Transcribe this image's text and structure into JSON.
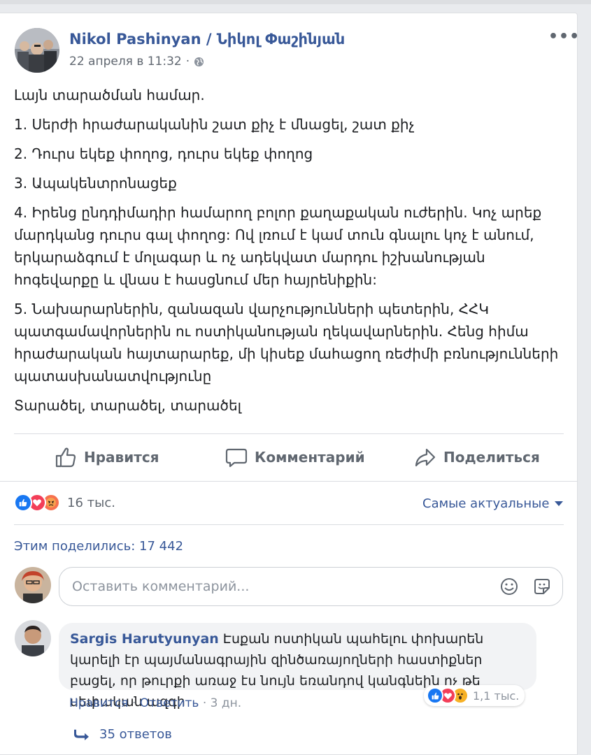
{
  "post": {
    "author": "Nikol Pashinyan / Նիկոլ Փաշինյան",
    "timestamp": "22 апреля в 11:32",
    "timestamp_sep": "·",
    "more": "•••",
    "paragraphs": [
      "Լայն տարածման համար.",
      "1. Սերժի հրաժարականին շատ քիչ է մնացել, շատ քիչ",
      "2. Դուրս եկեք փողոց, դուրս եկեք փողոց",
      "3. Ապակենտրոնացեք",
      "4. Իրենց ընդդիմադիր համարող բոլոր քաղաքական ուժերին. Կոչ արեք մարդկանց դուրս գալ փողոց: Ով լռում է կամ տուն գնալու կոչ է անում, երկարաձգում է մոլագար և ոչ ադեկվատ մարդու իշխանության հոգեվարքը և վնաս է հասցնում մեր հայրենիքին:",
      "5. Նախարարներին, զանազան վարչությունների պետերին, ՀՀԿ պատգամավորներին ու ոստիկանության ղեկավարներին. Հենց հիմա հրաժարական հայտարարեք, մի կիսեք մահացող ռեժիմի բռնությունների պատասխանատվությունը",
      "Տարածել, տարածել, տարածել"
    ]
  },
  "actions": {
    "like": "Нравится",
    "comment": "Комментарий",
    "share": "Поделиться"
  },
  "reactions": {
    "count": "16 тыс.",
    "icons": [
      "like-icon",
      "love-icon",
      "angry-icon"
    ],
    "colors": {
      "like": "#1877f2",
      "love": "#f33e58",
      "angry": "#f7714e"
    }
  },
  "sort": {
    "label": "Самые актуальные"
  },
  "shares": {
    "label": "Этим поделились: 17 442"
  },
  "comment_box": {
    "placeholder": "Оставить комментарий..."
  },
  "comment": {
    "author": "Sargis Harutyunyan",
    "text": "Էսքան ոստիկան պահելու փոխարեն կարելի էր պայմանագրային զինծառայողների հաստիքներ բացել, որ թուրքի առաջ էս նույն եռանդով կանգնեին ոչ թե սեփական ազգի",
    "like": "Нравится",
    "dot1": "·",
    "reply": "Ответить",
    "dot2": "·",
    "age": "3 дн.",
    "reaction_count": "1,1 тыс.",
    "replies": "35 ответов"
  },
  "colors": {
    "link": "#385898",
    "muted": "#606770",
    "bg": "#e9ebee"
  }
}
